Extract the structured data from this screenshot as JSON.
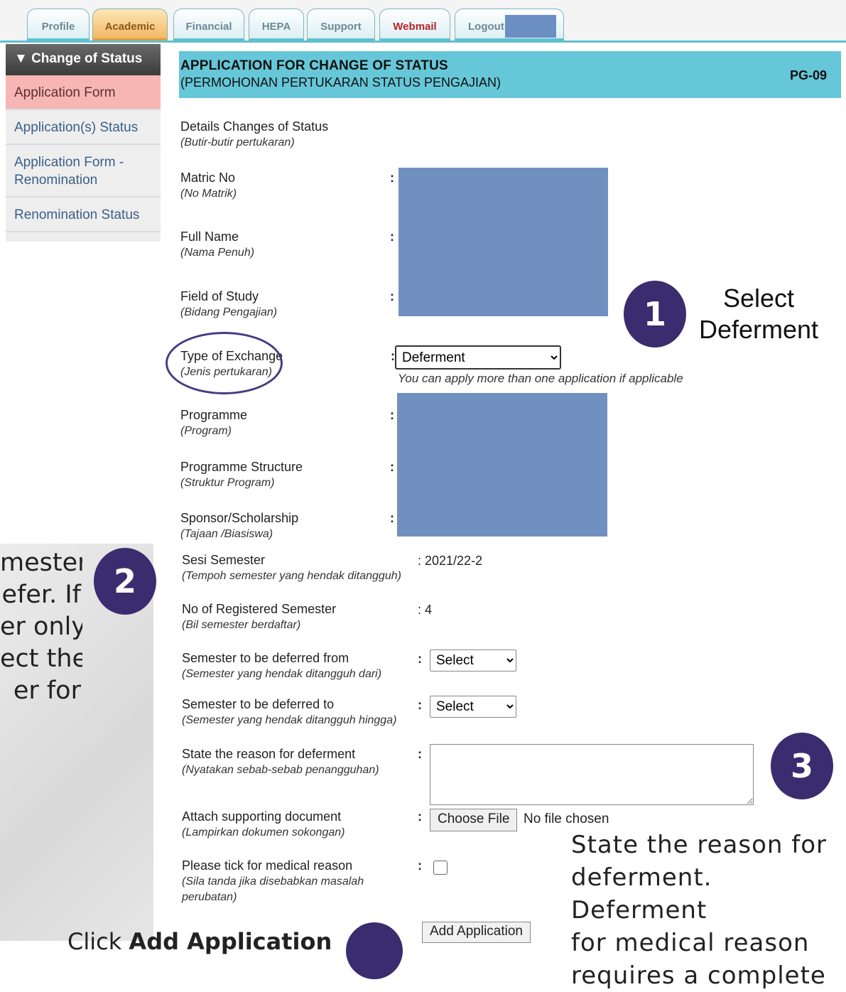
{
  "tabs": [
    {
      "label": "Profile"
    },
    {
      "label": "Academic"
    },
    {
      "label": "Financial"
    },
    {
      "label": "HEPA"
    },
    {
      "label": "Support"
    },
    {
      "label": "Webmail"
    },
    {
      "label": "Logout"
    }
  ],
  "sidebar": {
    "heading": "▼ Change of Status",
    "items": [
      {
        "label": "Application Form"
      },
      {
        "label": "Application(s) Status"
      },
      {
        "label": "Application Form - Renomination"
      },
      {
        "label": "Renomination Status"
      }
    ]
  },
  "form": {
    "title": "APPLICATION FOR CHANGE OF STATUS",
    "subtitle": "(PERMOHONAN PERTUKARAN STATUS PENGAJIAN)",
    "code": "PG-09",
    "details": {
      "label": "Details Changes of Status",
      "label_ms": "(Butir-butir pertukaran)"
    },
    "matric": {
      "label": "Matric No",
      "label_ms": "(No Matrik)"
    },
    "fullname": {
      "label": "Full Name",
      "label_ms": "(Nama Penuh)"
    },
    "field": {
      "label": "Field of Study",
      "label_ms": "(Bidang Pengajian)"
    },
    "type": {
      "label": "Type of Exchange",
      "label_ms": "(Jenis pertukaran)",
      "value": "Deferment",
      "hint": "You can apply more than one application if applicable"
    },
    "programme": {
      "label": "Programme",
      "label_ms": "(Program)"
    },
    "structure": {
      "label": "Programme Structure",
      "label_ms": "(Struktur Program)"
    },
    "sponsor": {
      "label": "Sponsor/Scholarship",
      "label_ms": "(Tajaan /Biasiswa)"
    },
    "sesi": {
      "label": "Sesi Semester",
      "label_ms": "(Tempoh semester yang hendak ditangguh)",
      "value": ": 2021/22-2"
    },
    "registered": {
      "label": "No of Registered Semester",
      "label_ms": "(Bil semester berdaftar)",
      "value": ": 4"
    },
    "from": {
      "label": "Semester to be deferred from",
      "label_ms": "(Semester yang hendak ditangguh dari)",
      "value": "Select"
    },
    "to": {
      "label": "Semester to be deferred to",
      "label_ms": "(Semester yang hendak ditangguh hingga)",
      "value": "Select"
    },
    "reason": {
      "label": "State the reason for deferment",
      "label_ms": "(Nyatakan sebab-sebab penangguhan)"
    },
    "attach": {
      "label": "Attach supporting document",
      "label_ms": "(Lampirkan dokumen sokongan)",
      "button": "Choose File",
      "status": "No file chosen"
    },
    "medical": {
      "label": "Please tick for medical reason",
      "label_ms1": "(Sila tanda jika disebabkan masalah",
      "label_ms2": "perubatan)"
    },
    "add_button": "Add Application"
  },
  "annotations": {
    "step1": {
      "number": "1",
      "line1": "Select",
      "line2": "Deferment"
    },
    "step2": {
      "number": "2",
      "lines": [
        "mester",
        "efer. If",
        "er only",
        "ect the",
        "er for"
      ]
    },
    "step3": {
      "number": "3",
      "lines": [
        "State the reason for",
        "deferment. Deferment",
        "for medical reason",
        "requires a complete"
      ]
    },
    "step4": {
      "prefix": "Click ",
      "bold": "Add Application"
    }
  }
}
